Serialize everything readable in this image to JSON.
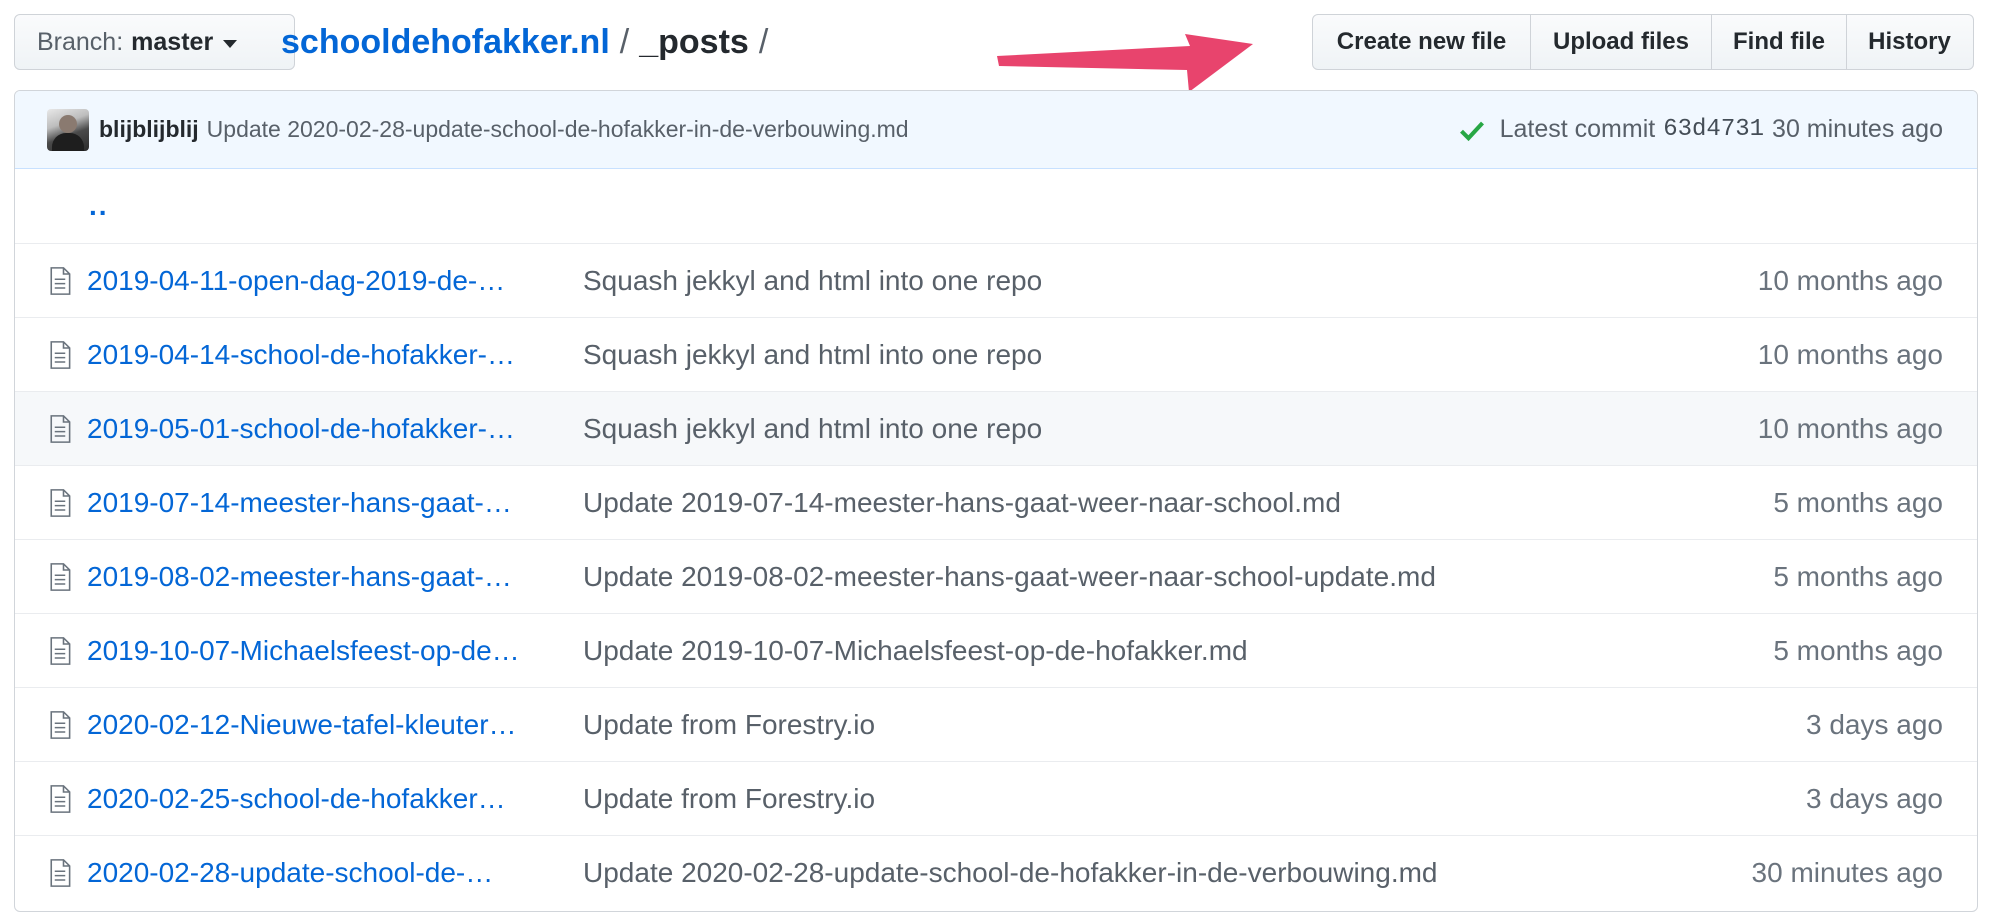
{
  "branch": {
    "label": "Branch:",
    "value": "master"
  },
  "breadcrumb": {
    "repo": "schooldehofakker.nl",
    "separator": "/",
    "dir": "_posts",
    "trailing": "/"
  },
  "actions": {
    "create_new_file": "Create new file",
    "upload_files": "Upload files",
    "find_file": "Find file",
    "history": "History"
  },
  "commit": {
    "author": "blijblijblij",
    "message": "Update 2020-02-28-update-school-de-hofakker-in-de-verbouwing.md",
    "latest_label": "Latest commit",
    "sha": "63d4731",
    "time": "30 minutes ago"
  },
  "parent_link": "..",
  "files": [
    {
      "name": "2019-04-11-open-dag-2019-de-…",
      "message": "Squash jekkyl and html into one repo",
      "age": "10 months ago"
    },
    {
      "name": "2019-04-14-school-de-hofakker-…",
      "message": "Squash jekkyl and html into one repo",
      "age": "10 months ago"
    },
    {
      "name": "2019-05-01-school-de-hofakker-…",
      "message": "Squash jekkyl and html into one repo",
      "age": "10 months ago"
    },
    {
      "name": "2019-07-14-meester-hans-gaat-…",
      "message": "Update 2019-07-14-meester-hans-gaat-weer-naar-school.md",
      "age": "5 months ago"
    },
    {
      "name": "2019-08-02-meester-hans-gaat-…",
      "message": "Update 2019-08-02-meester-hans-gaat-weer-naar-school-update.md",
      "age": "5 months ago"
    },
    {
      "name": "2019-10-07-Michaelsfeest-op-de…",
      "message": "Update 2019-10-07-Michaelsfeest-op-de-hofakker.md",
      "age": "5 months ago"
    },
    {
      "name": "2020-02-12-Nieuwe-tafel-kleuter…",
      "message": "Update from Forestry.io",
      "age": "3 days ago"
    },
    {
      "name": "2020-02-25-school-de-hofakker…",
      "message": "Update from Forestry.io",
      "age": "3 days ago"
    },
    {
      "name": "2020-02-28-update-school-de-…",
      "message": "Update 2020-02-28-update-school-de-hofakker-in-de-verbouwing.md",
      "age": "30 minutes ago"
    }
  ],
  "colors": {
    "link": "#0366d6",
    "arrow": "#e8446d",
    "check": "#28a745",
    "commit_bg": "#f1f8ff"
  }
}
